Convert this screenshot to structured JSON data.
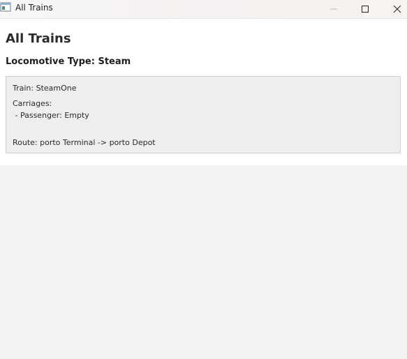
{
  "window": {
    "title": "All Trains",
    "icon": "app-window-icon",
    "controls": {
      "minimize_icon": "minimize-icon",
      "maximize_icon": "maximize-icon",
      "close_icon": "close-icon"
    }
  },
  "main": {
    "title": "All Trains",
    "locomotive_type": "Locomotive Type: Steam"
  },
  "train_card": {
    "train": "Train: SteamOne",
    "carriages_label": "Carriages:",
    "carriages": [
      " - Passenger: Empty"
    ],
    "route": "Route: porto Terminal -> porto Depot"
  },
  "colors": {
    "content_bg": "#ffffff",
    "window_bg": "#f3f3f3",
    "card_bg": "#eeeeee",
    "card_border": "#cfcfcf"
  }
}
